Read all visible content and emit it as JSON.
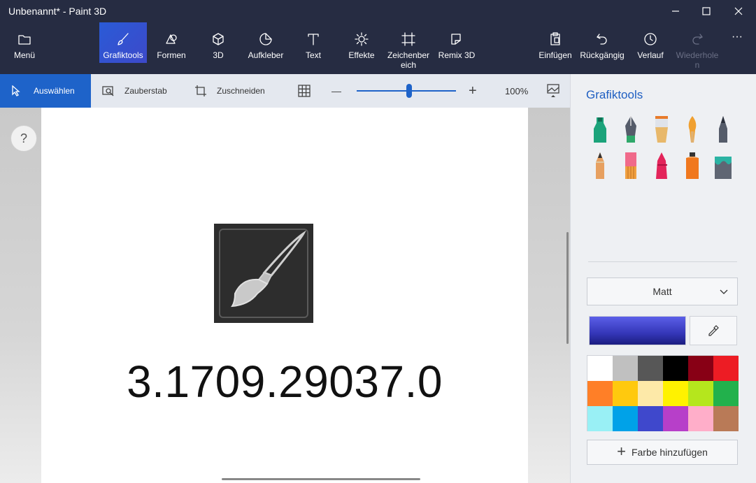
{
  "window": {
    "title": "Unbenannt* - Paint 3D"
  },
  "ribbon": {
    "menu": "Menü",
    "brushes": "Grafiktools",
    "shapes": "Formen",
    "three_d": "3D",
    "stickers": "Aufkleber",
    "text": "Text",
    "effects": "Effekte",
    "canvas_line1": "Zeichenber",
    "canvas_line2": "eich",
    "remix": "Remix 3D",
    "paste": "Einfügen",
    "undo": "Rückgängig",
    "history": "Verlauf",
    "redo_line1": "Wiederhole",
    "redo_line2": "n",
    "more": "···"
  },
  "subbar": {
    "select": "Auswählen",
    "magic_select": "Zauberstab",
    "crop": "Zuschneiden",
    "zoom_minus": "—",
    "zoom_plus": "+",
    "zoom_level": "100%",
    "zoom_fraction": 0.5
  },
  "canvas": {
    "help": "?",
    "version": "3.1709.29037.0"
  },
  "panel": {
    "title": "Grafiktools",
    "tools": [
      {
        "name": "marker-icon",
        "color": "#1ba37a"
      },
      {
        "name": "calligraphy-pen-icon",
        "color": "#2fa86a"
      },
      {
        "name": "oil-brush-icon",
        "color": "#e8b86a"
      },
      {
        "name": "watercolor-icon",
        "color": "#f0a030"
      },
      {
        "name": "pixel-pen-icon",
        "color": "#555c6a"
      },
      {
        "name": "pencil-icon",
        "color": "#e7a060"
      },
      {
        "name": "eraser-icon",
        "color": "#f06a8a"
      },
      {
        "name": "crayon-icon",
        "color": "#e3245a"
      },
      {
        "name": "spray-can-icon",
        "color": "#f0781e"
      },
      {
        "name": "fill-bucket-icon",
        "color": "#2bb3a3"
      }
    ],
    "finish": "Matt",
    "current_color": "#3436b8",
    "palette": [
      "#ffffff",
      "#c0c0c0",
      "#575757",
      "#000000",
      "#880015",
      "#ed1c24",
      "#ff7f27",
      "#ffc90e",
      "#fde9a8",
      "#fff200",
      "#b5e61d",
      "#22b14c",
      "#99f0f5",
      "#00a2e8",
      "#3f48cc",
      "#b73fc9",
      "#ffaec9",
      "#b97a57"
    ],
    "add_color": "Farbe hinzufügen"
  }
}
